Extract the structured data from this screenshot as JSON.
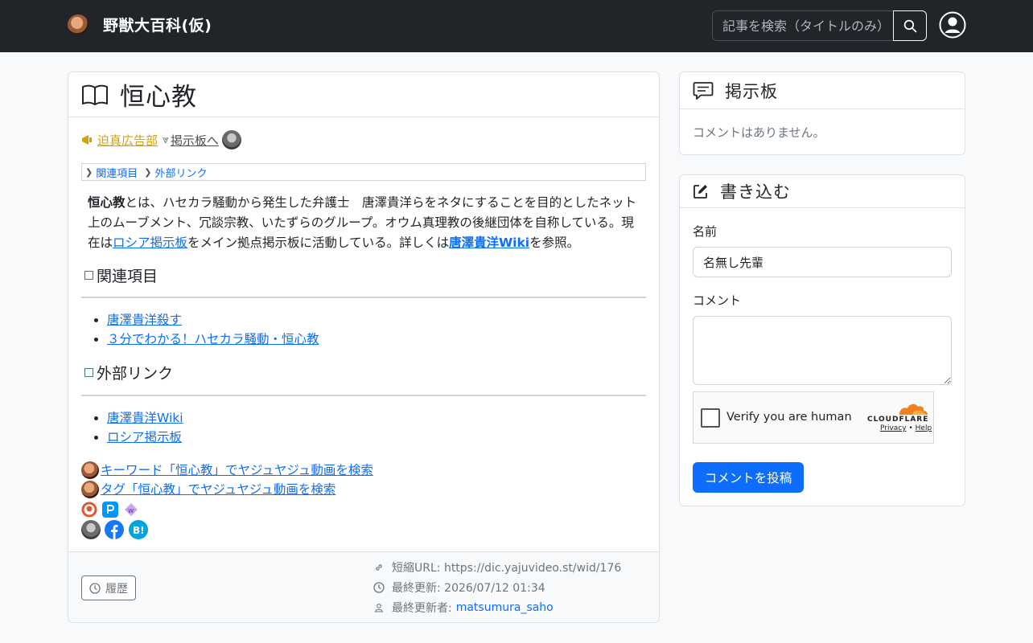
{
  "navbar": {
    "title": "野獣大百科(仮)",
    "search_placeholder": "記事を検索（タイトルのみ）"
  },
  "article": {
    "title": "恒心教",
    "ad_label": "迫真広告部",
    "board_link": "掲示板へ",
    "toc": [
      "関連項目",
      "外部リンク"
    ],
    "intro": {
      "term": "恒心教",
      "text1": "とは、ハセカラ騒動から発生した弁護士　唐澤貴洋らをネタにすることを目的としたネット上のムーブメント、冗談宗教、いたずらのグループ。オウム真理教の後継団体を自称している。現在は",
      "link1": "ロシア掲示板",
      "text2": "をメイン拠点掲示板に活動している。詳しくは",
      "link2": "唐澤貴洋Wiki",
      "text3": "を参照。"
    },
    "sections": [
      {
        "title": "関連項目",
        "links": [
          "唐澤貴洋殺す",
          "３分でわかる！ハセカラ騒動・恒心教"
        ]
      },
      {
        "title": "外部リンク",
        "links": [
          "唐澤貴洋Wiki",
          "ロシア掲示板"
        ]
      }
    ],
    "search_links": [
      "キーワード「恒心教」でヤジュヤジュ動画を検索",
      "タグ「恒心教」でヤジュヤジュ動画を検索"
    ],
    "footer": {
      "history_label": "履歴",
      "short_url": "短縮URL: https://dic.yajuvideo.st/wid/176",
      "updated": "最終更新: 2026/07/12 01:34",
      "updated_by_label": "最終更新者:",
      "updated_by": "matsumura_saho"
    }
  },
  "board": {
    "title": "掲示板",
    "empty": "コメントはありません。"
  },
  "write": {
    "title": "書き込む",
    "name_label": "名前",
    "name_value": "名無し先輩",
    "comment_label": "コメント",
    "captcha_label": "Verify you are human",
    "captcha_brand": "CLOUDFLARE",
    "captcha_privacy": "Privacy",
    "captcha_dot": "•",
    "captcha_help": "Help",
    "submit": "コメントを投稿"
  },
  "colors": {
    "navbar_bg": "#212529",
    "primary": "#0d6efd",
    "ad_yellow": "#d4a108",
    "cloudflare_orange": "#f38020"
  }
}
